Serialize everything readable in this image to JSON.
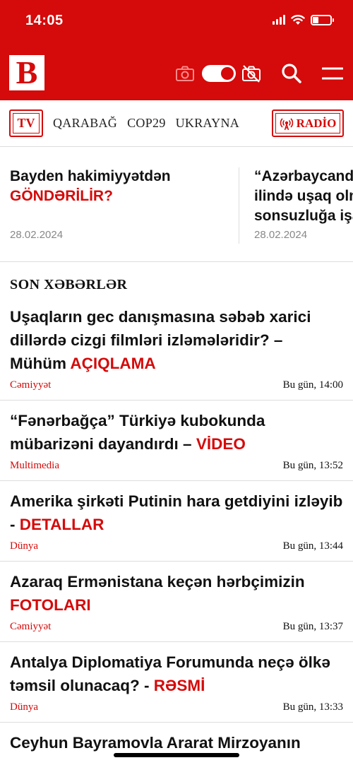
{
  "status_bar": {
    "time": "14:05"
  },
  "header": {
    "logo_letter": "B",
    "icons": [
      "camera-icon",
      "theme-toggle",
      "camera-off-icon",
      "search-icon",
      "menu-icon"
    ]
  },
  "nav": {
    "tv_label": "TV",
    "links": [
      "QARABAĞ",
      "COP29",
      "UKRAYNA"
    ],
    "radio_label": "RADİO"
  },
  "featured": [
    {
      "title_lines": [
        "Bayden hakimiyyətdən"
      ],
      "accent": "GÖNDƏRİLİR?",
      "date": "28.02.2024"
    },
    {
      "title_lines": [
        "“Azərbaycanda",
        "ilində uşaq olm",
        "sonsuzluğa işa"
      ],
      "accent": "",
      "date": "28.02.2024"
    }
  ],
  "section": {
    "title": "SON XƏBƏRLƏR"
  },
  "news": [
    {
      "title": "Uşaqların gec danışmasına səbəb xarici dillərdə cizgi filmləri izləmələridir? – Mühüm ",
      "accent": "AÇIQLAMA",
      "category": "Cəmiyyət",
      "time": "Bu gün, 14:00"
    },
    {
      "title": "“Fənərbağça” Türkiyə kubokunda mübarizəni dayandırdı – ",
      "accent": "VİDEO",
      "category": "Multimedia",
      "time": "Bu gün, 13:52"
    },
    {
      "title": "Amerika şirkəti Putinin hara getdiyini izləyib - ",
      "accent": "DETALLAR",
      "category": "Dünya",
      "time": "Bu gün, 13:44"
    },
    {
      "title": "Azaraq Ermənistana keçən hərbçimizin ",
      "accent": "FOTOLARI",
      "category": "Cəmiyyət",
      "time": "Bu gün, 13:37"
    },
    {
      "title": "Antalya Diplomatiya Forumunda neçə ölkə təmsil olunacaq? - ",
      "accent": "RƏSMİ",
      "category": "Dünya",
      "time": "Bu gün, 13:33"
    },
    {
      "title": "Ceyhun Bayramovla Ararat Mirzoyanın",
      "accent": "",
      "category": "",
      "time": ""
    }
  ],
  "colors": {
    "brand": "#d50a0a",
    "text": "#111111",
    "muted": "#888888",
    "divider": "#dddddd"
  }
}
